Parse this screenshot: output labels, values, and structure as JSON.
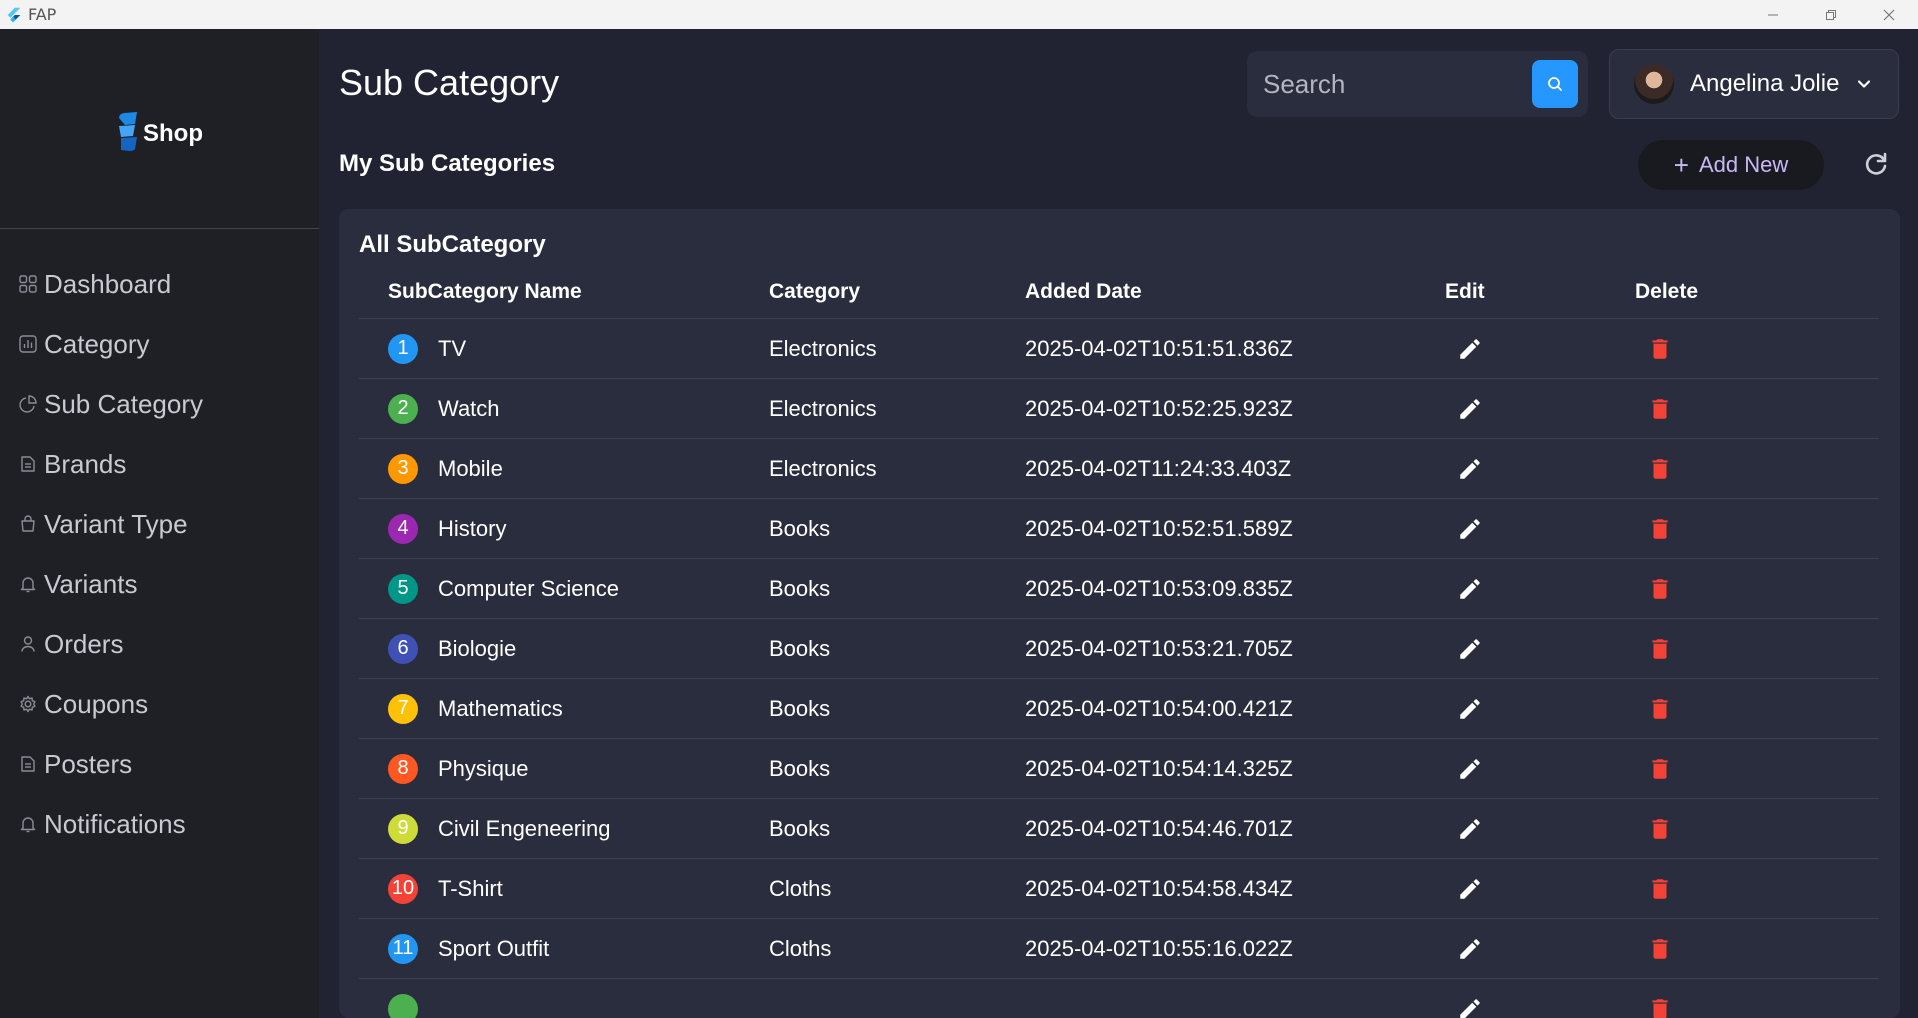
{
  "window": {
    "title": "FAP"
  },
  "sidebar": {
    "logo_text": "Shop",
    "items": [
      {
        "label": "Dashboard",
        "icon": "dashboard-icon"
      },
      {
        "label": "Category",
        "icon": "chart-icon"
      },
      {
        "label": "Sub Category",
        "icon": "pie-chart-icon"
      },
      {
        "label": "Brands",
        "icon": "document-icon"
      },
      {
        "label": "Variant Type",
        "icon": "bag-icon"
      },
      {
        "label": "Variants",
        "icon": "bell-icon"
      },
      {
        "label": "Orders",
        "icon": "user-icon"
      },
      {
        "label": "Coupons",
        "icon": "gear-icon"
      },
      {
        "label": "Posters",
        "icon": "document-icon"
      },
      {
        "label": "Notifications",
        "icon": "bell-icon"
      }
    ]
  },
  "header": {
    "title": "Sub Category",
    "search_placeholder": "Search",
    "user_name": "Angelina Jolie"
  },
  "subheader": {
    "title": "My Sub Categories",
    "add_label": "Add New"
  },
  "table": {
    "title": "All SubCategory",
    "columns": [
      "SubCategory Name",
      "Category",
      "Added Date",
      "Edit",
      "Delete"
    ],
    "rows": [
      {
        "num": "1",
        "color": "#2196f3",
        "name": "TV",
        "category": "Electronics",
        "date": "2025-04-02T10:51:51.836Z"
      },
      {
        "num": "2",
        "color": "#4caf50",
        "name": "Watch",
        "category": "Electronics",
        "date": "2025-04-02T10:52:25.923Z"
      },
      {
        "num": "3",
        "color": "#ff9800",
        "name": "Mobile",
        "category": "Electronics",
        "date": "2025-04-02T11:24:33.403Z"
      },
      {
        "num": "4",
        "color": "#9c27b0",
        "name": "History",
        "category": "Books",
        "date": "2025-04-02T10:52:51.589Z"
      },
      {
        "num": "5",
        "color": "#009688",
        "name": "Computer Science",
        "category": "Books",
        "date": "2025-04-02T10:53:09.835Z"
      },
      {
        "num": "6",
        "color": "#3f51b5",
        "name": "Biologie",
        "category": "Books",
        "date": "2025-04-02T10:53:21.705Z"
      },
      {
        "num": "7",
        "color": "#ffc107",
        "name": "Mathematics",
        "category": "Books",
        "date": "2025-04-02T10:54:00.421Z"
      },
      {
        "num": "8",
        "color": "#ff5722",
        "name": "Physique",
        "category": "Books",
        "date": "2025-04-02T10:54:14.325Z"
      },
      {
        "num": "9",
        "color": "#cddc39",
        "name": "Civil Engeneering",
        "category": "Books",
        "date": "2025-04-02T10:54:46.701Z"
      },
      {
        "num": "10",
        "color": "#f44336",
        "name": "T-Shirt",
        "category": "Cloths",
        "date": "2025-04-02T10:54:58.434Z"
      },
      {
        "num": "11",
        "color": "#2196f3",
        "name": "Sport Outfit",
        "category": "Cloths",
        "date": "2025-04-02T10:55:16.022Z"
      },
      {
        "num": "",
        "color": "#4caf50",
        "name": "",
        "category": "",
        "date": ""
      }
    ]
  },
  "colors": {
    "accent": "#2697ff",
    "delete": "#f44336",
    "background": "#212332",
    "card": "#2a2d3e"
  }
}
